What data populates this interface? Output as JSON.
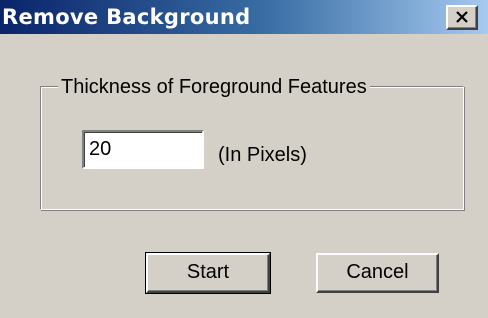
{
  "window": {
    "title": "Remove Background",
    "close_icon": "close-x-icon"
  },
  "group": {
    "legend": "Thickness of Foreground Features",
    "thickness_value": "20",
    "units_label": "(In Pixels)"
  },
  "buttons": {
    "start_label": "Start",
    "cancel_label": "Cancel"
  },
  "colors": {
    "titlebar_start": "#0a246a",
    "titlebar_end": "#a6caf0",
    "face": "#d4d0c8"
  }
}
